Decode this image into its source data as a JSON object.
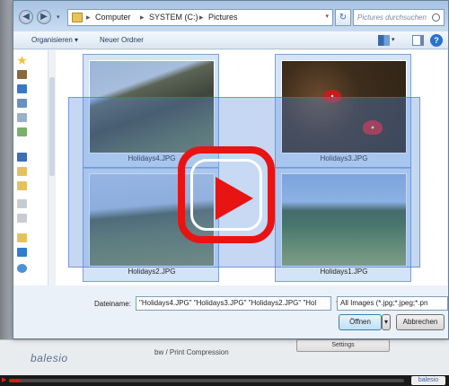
{
  "address": {
    "segments": [
      "Computer",
      "SYSTEM (C:)",
      "Pictures"
    ],
    "separator": "▸"
  },
  "search": {
    "placeholder": "Pictures durchsuchen"
  },
  "toolbar": {
    "organize": "Organisieren ▾",
    "new_folder": "Neuer Ordner"
  },
  "files": [
    {
      "name": "Holidays4.JPG"
    },
    {
      "name": "Holidays3.JPG"
    },
    {
      "name": "Holidays2.JPG"
    },
    {
      "name": "Holidays1.JPG"
    }
  ],
  "footer": {
    "filename_label": "Dateiname:",
    "filename_value": "\"Holidays4.JPG\" \"Holidays3.JPG\" \"Holidays2.JPG\" \"Hol",
    "filter_value": "All Images  (*.jpg;*.jpeg;*.pn",
    "open_button": "Öffnen",
    "cancel_button": "Abbrechen"
  },
  "background": {
    "brand": "balesio",
    "compression_label": "bw / Print Compression",
    "settings_button": "Settings"
  },
  "player": {
    "progress_fraction": 0.03,
    "logo": "balesio"
  },
  "colors": {
    "accent_red": "#e81414",
    "selection_blue": "#5a8cdc"
  }
}
